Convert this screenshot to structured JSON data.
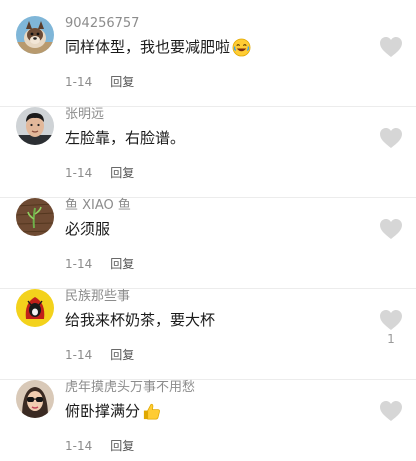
{
  "comments": [
    {
      "username": "904256757",
      "text": "同样体型，我也要减肥啦",
      "emoji": "rolling-laugh-emoji",
      "date": "1-14",
      "reply": "回复",
      "likes": "",
      "avatar": "dog-avatar"
    },
    {
      "username": "张明远",
      "text": "左脸靠，右脸谱。",
      "emoji": "",
      "date": "1-14",
      "reply": "回复",
      "likes": "",
      "avatar": "man-photo-avatar"
    },
    {
      "username": "鱼 XIAO 鱼",
      "text": "必须服",
      "emoji": "",
      "date": "1-14",
      "reply": "回复",
      "likes": "",
      "avatar": "plant-on-wood-avatar"
    },
    {
      "username": "民族那些事",
      "text": "给我来杯奶茶，要大杯",
      "emoji": "",
      "date": "1-14",
      "reply": "回复",
      "likes": "1",
      "avatar": "cartoon-avatar"
    },
    {
      "username": "虎年摸虎头万事不用愁",
      "text": "俯卧撑满分",
      "emoji": "thumbs-up-emoji",
      "date": "1-14",
      "reply": "回复",
      "likes": "",
      "avatar": "woman-sunglasses-avatar"
    }
  ],
  "colors": {
    "username": "#8c8c8c",
    "text": "#1a1a1a",
    "meta": "#8c8c8c",
    "heart": "#d6d6d6"
  }
}
